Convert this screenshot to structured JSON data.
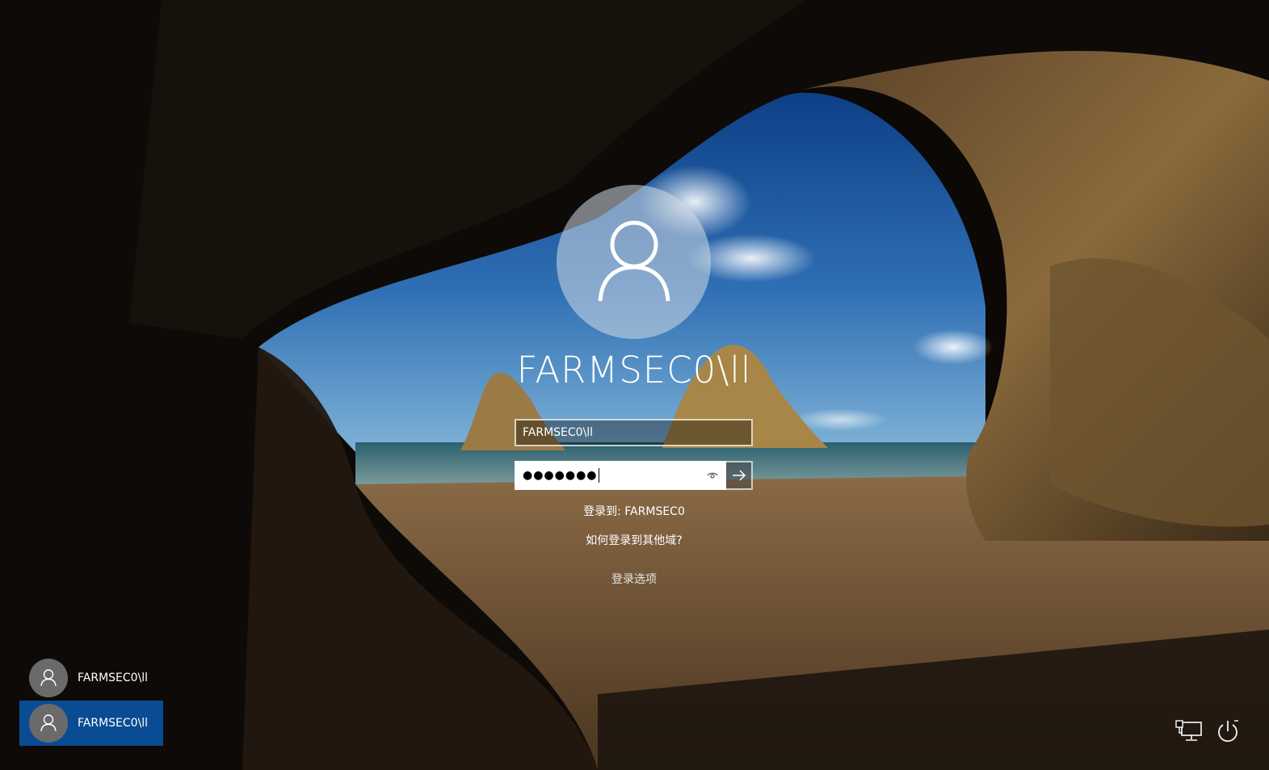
{
  "login": {
    "username_title": "FARMSEC0\\ll",
    "username_field_value": "FARMSEC0\\ll",
    "password_mask": "●●●●●●●",
    "sign_in_to": "登录到: FARMSEC0",
    "other_domain_link": "如何登录到其他域?",
    "sign_in_options": "登录选项"
  },
  "users": [
    {
      "label": "FARMSEC0\\ll",
      "selected": false
    },
    {
      "label": "FARMSEC0\\ll",
      "selected": true
    }
  ],
  "icons": {
    "avatar": "person-icon",
    "reveal": "eye-icon",
    "submit": "arrow-right-icon",
    "network": "network-icon",
    "power": "power-icon"
  },
  "colors": {
    "selected_tile": "#0a4c94",
    "avatar_bg": "#6a6a6a"
  }
}
